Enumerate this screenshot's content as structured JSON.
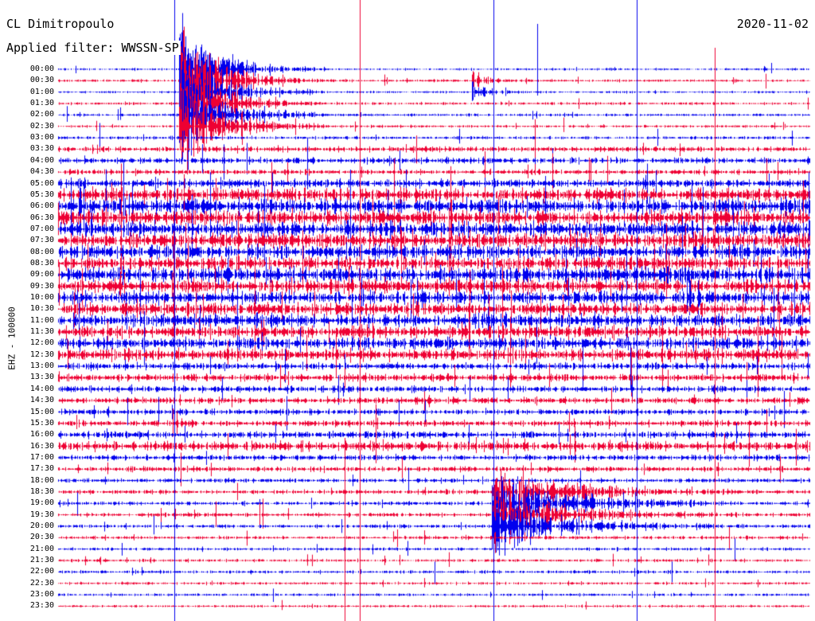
{
  "header": {
    "station": "CL Dimitropoulo",
    "date": "2020-11-02",
    "filter": "Applied filter: WWSSN-SP"
  },
  "chart_data": {
    "type": "line",
    "title": "CL Dimitropoulo",
    "ylabel": "EHZ - 100000",
    "row_labels": [
      "00:00",
      "00:30",
      "01:00",
      "01:30",
      "02:00",
      "02:30",
      "03:00",
      "03:30",
      "04:00",
      "04:30",
      "05:00",
      "05:30",
      "06:00",
      "06:30",
      "07:00",
      "07:30",
      "08:00",
      "08:30",
      "09:00",
      "09:30",
      "10:00",
      "10:30",
      "11:00",
      "11:30",
      "12:00",
      "12:30",
      "13:00",
      "13:30",
      "14:00",
      "14:30",
      "15:00",
      "15:30",
      "16:00",
      "16:30",
      "17:00",
      "17:30",
      "18:00",
      "18:30",
      "19:00",
      "19:30",
      "20:00",
      "20:30",
      "21:00",
      "21:30",
      "22:00",
      "22:30",
      "23:00",
      "23:30"
    ],
    "row_interval_minutes": 30,
    "series_colors": [
      "#0000ee",
      "#ee0033"
    ],
    "row_noise_level": [
      0.5,
      0.6,
      0.5,
      0.6,
      0.6,
      0.6,
      0.7,
      1.2,
      1.4,
      1.2,
      2.0,
      3.0,
      3.5,
      3.5,
      3.5,
      3.5,
      3.2,
      3.0,
      3.5,
      3.2,
      3.0,
      3.0,
      3.0,
      2.8,
      2.8,
      2.8,
      1.6,
      1.8,
      1.5,
      1.5,
      1.3,
      1.4,
      1.6,
      2.2,
      1.3,
      1.2,
      1.0,
      1.0,
      0.9,
      0.9,
      0.8,
      0.8,
      0.7,
      0.7,
      0.7,
      0.6,
      0.6,
      0.6
    ],
    "events": [
      {
        "row": 0,
        "minute": 4.8,
        "amplitude": 9,
        "duration_minutes": 1.5
      },
      {
        "row": 37,
        "minute": 17.3,
        "amplitude": 5,
        "duration_minutes": 2.5
      },
      {
        "row": 1,
        "minute": 16.5,
        "amplitude": 2,
        "duration_minutes": 0.5
      }
    ]
  }
}
